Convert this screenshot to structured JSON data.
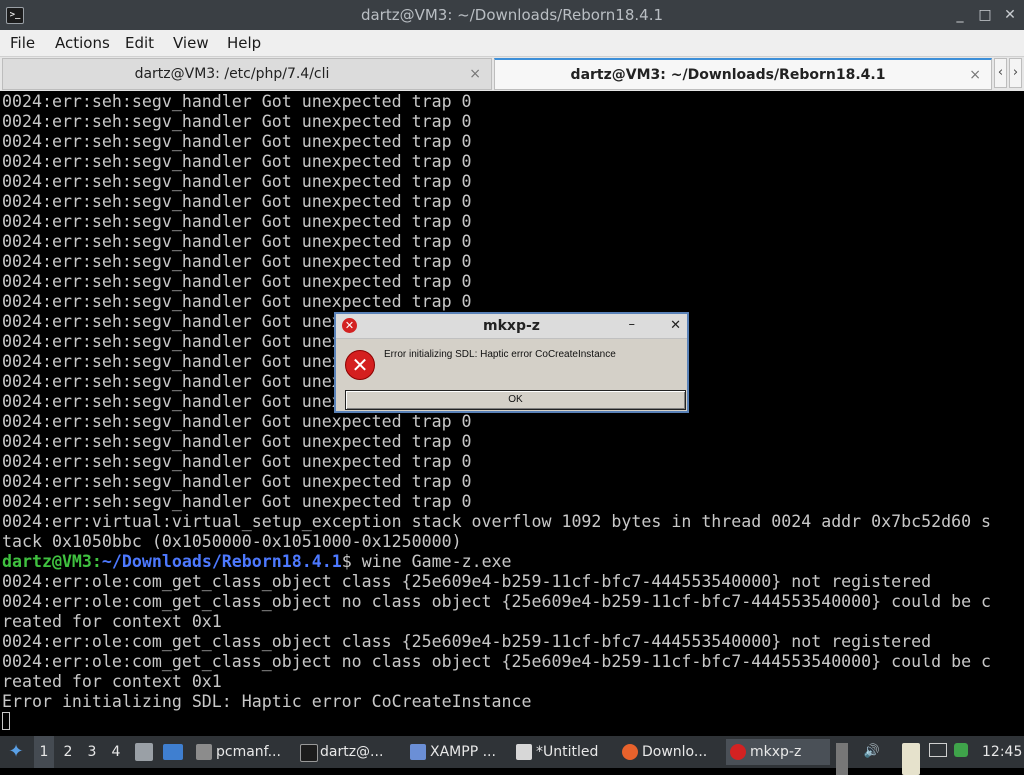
{
  "window": {
    "title": "dartz@VM3: ~/Downloads/Reborn18.4.1",
    "controls": {
      "minimize": "_",
      "maximize": "□",
      "close": "✕"
    }
  },
  "menu": [
    "File",
    "Actions",
    "Edit",
    "View",
    "Help"
  ],
  "tabs": [
    {
      "label": "dartz@VM3: /etc/php/7.4/cli",
      "close": "×"
    },
    {
      "label": "dartz@VM3: ~/Downloads/Reborn18.4.1",
      "close": "×"
    }
  ],
  "tab_scroll": {
    "left": "‹",
    "right": "›"
  },
  "terminal": {
    "trap_line": "0024:err:seh:segv_handler Got unexpected trap 0",
    "trap_count": 21,
    "lines": [
      "0024:err:virtual:virtual_setup_exception stack overflow 1092 bytes in thread 0024 addr 0x7bc52d60 s",
      "tack 0x1050bbc (0x1050000-0x1051000-0x1250000)"
    ],
    "prompt_user": "dartz@VM3",
    "prompt_sep": ":",
    "prompt_path": "~/Downloads/Reborn18.4.1",
    "prompt_end": "$ ",
    "command": "wine Game-z.exe",
    "output": [
      "0024:err:ole:com_get_class_object class {25e609e4-b259-11cf-bfc7-444553540000} not registered",
      "0024:err:ole:com_get_class_object no class object {25e609e4-b259-11cf-bfc7-444553540000} could be c",
      "reated for context 0x1",
      "0024:err:ole:com_get_class_object class {25e609e4-b259-11cf-bfc7-444553540000} not registered",
      "0024:err:ole:com_get_class_object no class object {25e609e4-b259-11cf-bfc7-444553540000} could be c",
      "reated for context 0x1",
      "Error initializing SDL: Haptic error CoCreateInstance"
    ]
  },
  "dialog": {
    "title": "mkxp-z",
    "minimize": "–",
    "close": "✕",
    "message": "Error initializing SDL: Haptic error CoCreateInstance",
    "ok_label": "OK"
  },
  "panel": {
    "workspaces": [
      "1",
      "2",
      "3",
      "4"
    ],
    "active_workspace": "1",
    "tasks": [
      {
        "label": "pcmanf...",
        "icon_color": "#8c8c8c"
      },
      {
        "label": "dartz@...",
        "icon_color": "#1c1c1c"
      },
      {
        "label": "XAMPP ...",
        "icon_color": "#6b8fd6"
      },
      {
        "label": "*Untitled",
        "icon_color": "#d7d7d7"
      },
      {
        "label": "Downlo...",
        "icon_color": "#e8622c"
      },
      {
        "label": "mkxp-z",
        "icon_color": "#d32222"
      }
    ],
    "clock": "12:45"
  }
}
